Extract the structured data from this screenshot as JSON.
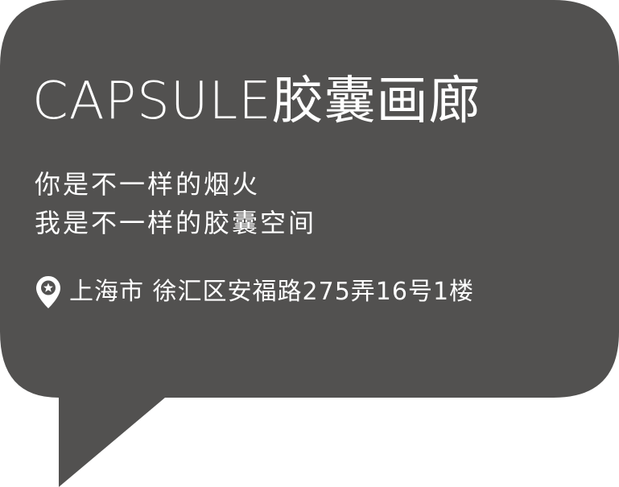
{
  "bubble": {
    "fill_color": "#525150",
    "text_color": "#ffffff"
  },
  "title": "CAPSULE胶囊画廊",
  "slogan": {
    "lines": [
      "你是不一样的烟火",
      "我是不一样的胶囊空间"
    ]
  },
  "address": {
    "icon": "location-pin-star-icon",
    "text": "上海市 徐汇区安福路275弄16号1楼"
  }
}
